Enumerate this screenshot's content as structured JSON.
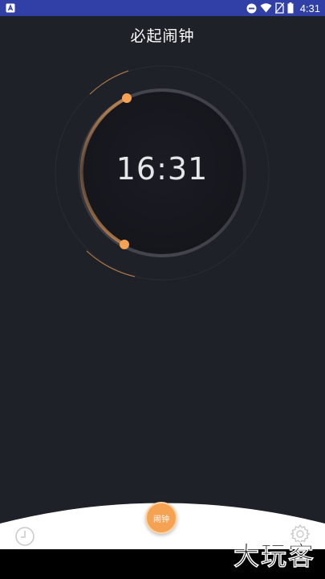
{
  "status_bar": {
    "time": "4:31",
    "icons": [
      "app-notification-icon",
      "do-not-disturb-icon",
      "wifi-icon",
      "no-sim-icon",
      "battery-icon"
    ],
    "background_color": "#3040a6"
  },
  "header": {
    "title": "必起闹钟"
  },
  "dial": {
    "time": "16:31",
    "accent_color": "#f5a253",
    "dial_color": "#1a1b23"
  },
  "bottom_nav": {
    "alarm_label": "闹钟",
    "left_icon": "clock-icon",
    "right_icon": "gear-icon"
  },
  "watermark": "大玩客"
}
